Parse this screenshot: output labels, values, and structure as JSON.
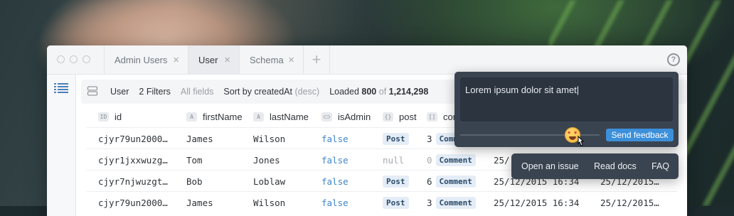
{
  "tabs": [
    {
      "label": "Admin Users",
      "close": "×"
    },
    {
      "label": "User",
      "close": "×"
    },
    {
      "label": "Schema",
      "close": "×"
    }
  ],
  "tab_add": "+",
  "help": "?",
  "toolbar": {
    "model": "User",
    "filters": "2 Filters",
    "fields": "All fields",
    "sort_prefix": "Sort by createdAt",
    "sort_dir": "(desc)",
    "loaded_label": "Loaded",
    "loaded_count": "800",
    "of": "of",
    "total": "1,214,298"
  },
  "columns": [
    {
      "badge": "ID",
      "label": "id"
    },
    {
      "badge": "A",
      "label": "firstName"
    },
    {
      "badge": "A",
      "label": "lastName"
    },
    {
      "badge": "⊂⊃",
      "label": "isAdmin"
    },
    {
      "badge": "{}",
      "label": "post"
    },
    {
      "badge": "[]",
      "label": "con"
    }
  ],
  "rows": [
    {
      "id": "cjyr79un2000…",
      "first": "James",
      "last": "Wilson",
      "admin": "false",
      "post": "Post",
      "count": "3",
      "comment": "Comm",
      "date1": "",
      "date2": ""
    },
    {
      "id": "cjyr1jxxwuzg…",
      "first": "Tom",
      "last": "Jones",
      "admin": "false",
      "post": "null",
      "count": "0",
      "comment": "Comment",
      "date1": "25/",
      "date2": ""
    },
    {
      "id": "cjyr7njwuzgt…",
      "first": "Bob",
      "last": "Loblaw",
      "admin": "false",
      "post": "Post",
      "count": "6",
      "comment": "Comment",
      "date1": "25/12/2015 16:34",
      "date2": "25/12/2015…"
    },
    {
      "id": "cjyr79un2000…",
      "first": "James",
      "last": "Wilson",
      "admin": "false",
      "post": "Post",
      "count": "3",
      "comment": "Comment",
      "date1": "25/12/2015 16:34",
      "date2": "25/12/2015…"
    }
  ],
  "feedback": {
    "text": "Lorem ipsum dolor sit amet",
    "send_label": "Send feedback"
  },
  "links": {
    "issue": "Open an issue",
    "docs": "Read docs",
    "faq": "FAQ"
  }
}
